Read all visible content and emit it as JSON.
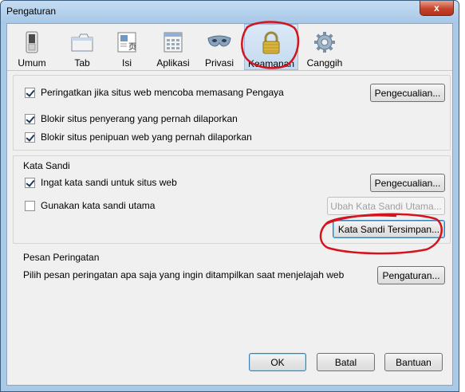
{
  "window": {
    "title": "Pengaturan",
    "close_glyph": "x"
  },
  "toolbar": {
    "tabs": [
      {
        "label": "Umum",
        "icon": "switch-icon"
      },
      {
        "label": "Tab",
        "icon": "tabs-icon"
      },
      {
        "label": "Isi",
        "icon": "content-icon"
      },
      {
        "label": "Aplikasi",
        "icon": "applications-icon"
      },
      {
        "label": "Privasi",
        "icon": "mask-icon"
      },
      {
        "label": "Keamanan",
        "icon": "padlock-icon",
        "selected": true
      },
      {
        "label": "Canggih",
        "icon": "gear-icon"
      }
    ]
  },
  "security": {
    "warn_addons": {
      "label": "Peringatkan jika situs web mencoba memasang Pengaya",
      "checked": true
    },
    "exceptions_button": "Pengecualian...",
    "block_attack": {
      "label": "Blokir situs penyerang yang pernah dilaporkan",
      "checked": true
    },
    "block_forgery": {
      "label": "Blokir situs penipuan web yang pernah dilaporkan",
      "checked": true
    }
  },
  "passwords": {
    "group_title": "Kata Sandi",
    "remember": {
      "label": "Ingat kata sandi untuk situs web",
      "checked": true
    },
    "exceptions_button": "Pengecualian...",
    "master": {
      "label": "Gunakan kata sandi utama",
      "checked": false
    },
    "change_master_button": "Ubah Kata Sandi Utama...",
    "saved_passwords_button": "Kata Sandi Tersimpan..."
  },
  "warnings": {
    "group_title": "Pesan Peringatan",
    "description": "Pilih pesan peringatan apa saja yang ingin ditampilkan saat menjelajah web",
    "settings_button": "Pengaturan..."
  },
  "footer": {
    "ok": "OK",
    "cancel": "Batal",
    "help": "Bantuan"
  },
  "colors": {
    "annotation_red": "#d4141c"
  }
}
